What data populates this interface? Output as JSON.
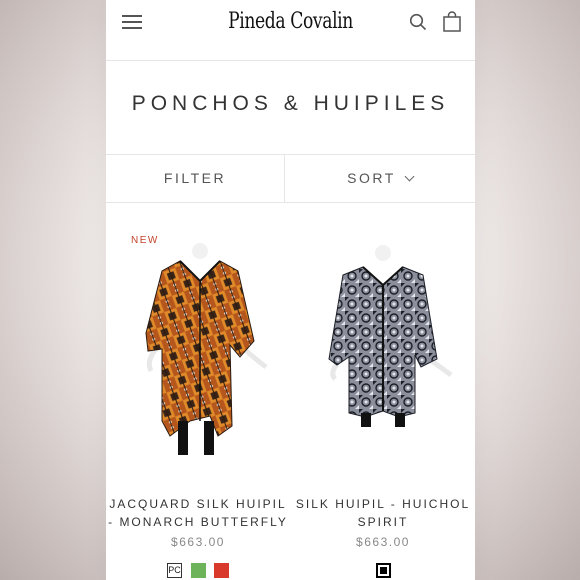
{
  "header": {
    "brand": "Pineda Covalin",
    "menu_icon": "hamburger-icon",
    "search_icon": "search-icon",
    "bag_icon": "shopping-bag-icon"
  },
  "page": {
    "title": "PONCHOS & HUIPILES"
  },
  "controls": {
    "filter_label": "FILTER",
    "sort_label": "SORT"
  },
  "products": [
    {
      "badge": "NEW",
      "name": "JACQUARD SILK HUIPIL - MONARCH BUTTERFLY",
      "price": "$663.00",
      "swatches": [
        {
          "label": "PC",
          "color": "#ffffff"
        },
        {
          "label": "",
          "color": "#6db35a"
        },
        {
          "label": "",
          "color": "#d8392b"
        }
      ]
    },
    {
      "badge": "",
      "name": "SILK HUIPIL - HUICHOL SPIRIT",
      "price": "$663.00",
      "swatches": [
        {
          "label": "",
          "color": "#000000"
        }
      ]
    }
  ],
  "colors": {
    "badge": "#c2432a",
    "text": "#333333",
    "price": "#888888"
  }
}
